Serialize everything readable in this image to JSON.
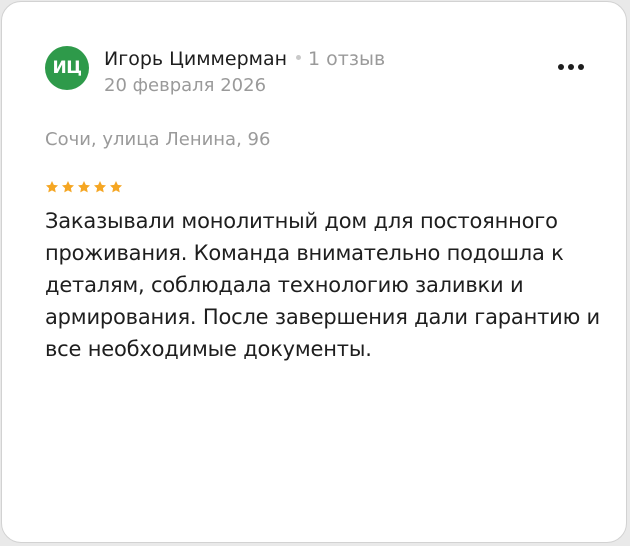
{
  "author": {
    "initials": "ИЦ",
    "name": "Игорь Циммерман",
    "reviews_count": "1 отзыв",
    "avatar_color": "#2e9a4a"
  },
  "review": {
    "date": "20 февраля 2026",
    "address": "Сочи, улица Ленина, 96",
    "rating": 5,
    "text": "Заказывали монолитный дом для постоянного проживания. Команда внимательно подошла к деталям, соблюдала технологию заливки и армирования. После завершения дали гарантию и все необходимые документы."
  },
  "colors": {
    "star": "#f5a623"
  },
  "icons": {
    "menu": "more-dots-icon",
    "rating": "star-icon"
  }
}
